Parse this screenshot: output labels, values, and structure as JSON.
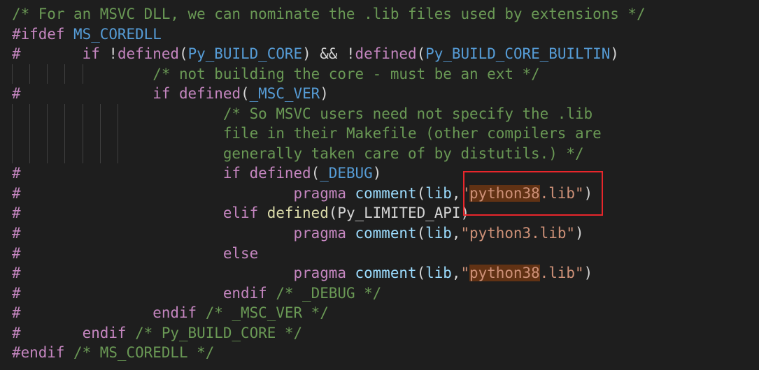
{
  "editor": {
    "lines": [
      {
        "guides": [],
        "tokens": [
          {
            "t": "/* For an MSVC DLL, we can nominate the .lib files used by extensions */",
            "c": "c-comment"
          }
        ]
      },
      {
        "guides": [],
        "tokens": [
          {
            "t": "#ifdef ",
            "c": "c-pp"
          },
          {
            "t": "MS_COREDLL",
            "c": "c-macro"
          }
        ]
      },
      {
        "guides": [],
        "tokens": [
          {
            "t": "#       ",
            "c": "c-pp"
          },
          {
            "t": "if ",
            "c": "c-pp"
          },
          {
            "t": "!",
            "c": "c-op"
          },
          {
            "t": "defined",
            "c": "c-pp"
          },
          {
            "t": "(",
            "c": "c-op"
          },
          {
            "t": "Py_BUILD_CORE",
            "c": "c-macro"
          },
          {
            "t": ") ",
            "c": "c-op"
          },
          {
            "t": "&&",
            "c": "c-op"
          },
          {
            "t": " !",
            "c": "c-op"
          },
          {
            "t": "defined",
            "c": "c-pp"
          },
          {
            "t": "(",
            "c": "c-op"
          },
          {
            "t": "Py_BUILD_CORE_BUILTIN",
            "c": "c-macro"
          },
          {
            "t": ")",
            "c": "c-op"
          }
        ]
      },
      {
        "guides": [
          1,
          2,
          3,
          4,
          5
        ],
        "tokens": [
          {
            "t": "                ",
            "c": "c-plain"
          },
          {
            "t": "/* not building the core - must be an ext */",
            "c": "c-comment"
          }
        ]
      },
      {
        "guides": [],
        "tokens": [
          {
            "t": "#               ",
            "c": "c-pp"
          },
          {
            "t": "if ",
            "c": "c-pp"
          },
          {
            "t": "defined",
            "c": "c-pp"
          },
          {
            "t": "(",
            "c": "c-op"
          },
          {
            "t": "_MSC_VER",
            "c": "c-macro"
          },
          {
            "t": ")",
            "c": "c-op"
          }
        ]
      },
      {
        "guides": [
          1,
          2,
          3,
          4,
          5,
          6,
          7
        ],
        "tokens": [
          {
            "t": "                        ",
            "c": "c-plain"
          },
          {
            "t": "/* So MSVC users need not specify the .lib",
            "c": "c-comment"
          }
        ]
      },
      {
        "guides": [
          1,
          2,
          3,
          4,
          5,
          6,
          7
        ],
        "tokens": [
          {
            "t": "                        ",
            "c": "c-plain"
          },
          {
            "t": "file in their Makefile (other compilers are",
            "c": "c-comment"
          }
        ]
      },
      {
        "guides": [
          1,
          2,
          3,
          4,
          5,
          6,
          7
        ],
        "tokens": [
          {
            "t": "                        ",
            "c": "c-plain"
          },
          {
            "t": "generally taken care of by distutils.) */",
            "c": "c-comment"
          }
        ]
      },
      {
        "guides": [],
        "tokens": [
          {
            "t": "#                       ",
            "c": "c-pp"
          },
          {
            "t": "if ",
            "c": "c-pp"
          },
          {
            "t": "defined",
            "c": "c-pp"
          },
          {
            "t": "(",
            "c": "c-op"
          },
          {
            "t": "_DEBUG",
            "c": "c-macro"
          },
          {
            "t": ")",
            "c": "c-op"
          }
        ]
      },
      {
        "guides": [],
        "tokens": [
          {
            "t": "#                               ",
            "c": "c-pp"
          },
          {
            "t": "pragma ",
            "c": "c-pp"
          },
          {
            "t": "comment",
            "c": "c-ident"
          },
          {
            "t": "(",
            "c": "c-op"
          },
          {
            "t": "lib",
            "c": "c-ident"
          },
          {
            "t": ",",
            "c": "c-op"
          },
          {
            "t": "\"",
            "c": "c-str"
          },
          {
            "t": "python38",
            "c": "c-str c-hl"
          },
          {
            "t": ".lib\"",
            "c": "c-str"
          },
          {
            "t": ")",
            "c": "c-op"
          }
        ]
      },
      {
        "guides": [],
        "tokens": [
          {
            "t": "#                       ",
            "c": "c-pp"
          },
          {
            "t": "elif ",
            "c": "c-pp"
          },
          {
            "t": "defined",
            "c": "c-fn"
          },
          {
            "t": "(",
            "c": "c-op"
          },
          {
            "t": "Py_LIMITED_API",
            "c": "c-plain"
          },
          {
            "t": ")",
            "c": "c-op"
          }
        ]
      },
      {
        "guides": [],
        "tokens": [
          {
            "t": "#                               ",
            "c": "c-pp"
          },
          {
            "t": "pragma ",
            "c": "c-pp"
          },
          {
            "t": "comment",
            "c": "c-ident"
          },
          {
            "t": "(",
            "c": "c-op"
          },
          {
            "t": "lib",
            "c": "c-ident"
          },
          {
            "t": ",",
            "c": "c-op"
          },
          {
            "t": "\"python3.lib\"",
            "c": "c-str"
          },
          {
            "t": ")",
            "c": "c-op"
          }
        ]
      },
      {
        "guides": [],
        "tokens": [
          {
            "t": "#                       ",
            "c": "c-pp"
          },
          {
            "t": "else",
            "c": "c-pp"
          }
        ]
      },
      {
        "guides": [],
        "tokens": [
          {
            "t": "#                               ",
            "c": "c-pp"
          },
          {
            "t": "pragma ",
            "c": "c-pp"
          },
          {
            "t": "comment",
            "c": "c-ident"
          },
          {
            "t": "(",
            "c": "c-op"
          },
          {
            "t": "lib",
            "c": "c-ident"
          },
          {
            "t": ",",
            "c": "c-op"
          },
          {
            "t": "\"",
            "c": "c-str"
          },
          {
            "t": "python38",
            "c": "c-str c-hl"
          },
          {
            "t": ".lib\"",
            "c": "c-str"
          },
          {
            "t": ")",
            "c": "c-op"
          }
        ]
      },
      {
        "guides": [],
        "tokens": [
          {
            "t": "#                       ",
            "c": "c-pp"
          },
          {
            "t": "endif ",
            "c": "c-pp"
          },
          {
            "t": "/* _DEBUG */",
            "c": "c-comment"
          }
        ]
      },
      {
        "guides": [],
        "tokens": [
          {
            "t": "#               ",
            "c": "c-pp"
          },
          {
            "t": "endif ",
            "c": "c-pp"
          },
          {
            "t": "/* _MSC_VER */",
            "c": "c-comment"
          }
        ]
      },
      {
        "guides": [],
        "tokens": [
          {
            "t": "#       ",
            "c": "c-pp"
          },
          {
            "t": "endif ",
            "c": "c-pp"
          },
          {
            "t": "/* Py_BUILD_CORE */",
            "c": "c-comment"
          }
        ]
      },
      {
        "guides": [],
        "tokens": [
          {
            "t": "#endif ",
            "c": "c-pp"
          },
          {
            "t": "/* MS_COREDLL */",
            "c": "c-comment"
          }
        ]
      }
    ]
  },
  "colors": {
    "background": "#1e1e1e",
    "comment": "#6a9955",
    "preprocessor": "#c586c0",
    "macro": "#569cd6",
    "identifier": "#9cdcfe",
    "function": "#dcdcaa",
    "string": "#ce9178",
    "search_highlight": "#613214",
    "annotation_box": "#e8262b"
  }
}
